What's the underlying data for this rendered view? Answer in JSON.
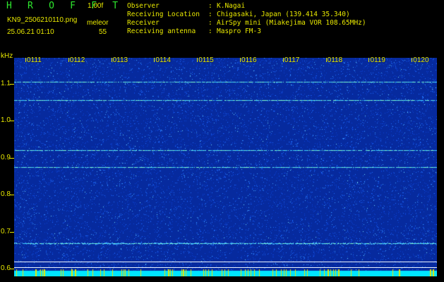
{
  "header": {
    "app_title": "H R O F F T",
    "version": "1.00f",
    "filename": "KN9_2506210110.png",
    "mode": "meleor",
    "datetime": "25.06.21 01:10",
    "count": "55",
    "info": [
      {
        "label": "Observer",
        "value": "K.Nagai"
      },
      {
        "label": "Receiving Location",
        "value": "Chigasaki, Japan (139.414 35.340)"
      },
      {
        "label": "Receiver",
        "value": "AirSpy mini (Miakejima VOR 108.65MHz)"
      },
      {
        "label": "Receiving antenna",
        "value": "Maspro FM-3"
      }
    ]
  },
  "chart_data": {
    "type": "heatmap",
    "ylabel": "kHz",
    "ylim": [
      0.58,
      1.17
    ],
    "y_ticks": [
      "1.1",
      "1.0",
      "0.9",
      "0.8",
      "0.7",
      "0.6"
    ],
    "x_ticks": [
      "0111",
      "0112",
      "0113",
      "0114",
      "0115",
      "0116",
      "0117",
      "0118",
      "0119",
      "0120"
    ],
    "carrier_lines_khz": [
      1.105,
      1.055,
      0.92,
      0.875,
      0.67
    ],
    "reference_lines_khz": [
      0.62,
      0.605
    ],
    "colors": {
      "background": "#062a9e",
      "noise": "#1f6cff",
      "signal": "#7fffd0",
      "labels": "#e8e800",
      "baseline": "#00e5ff"
    }
  }
}
